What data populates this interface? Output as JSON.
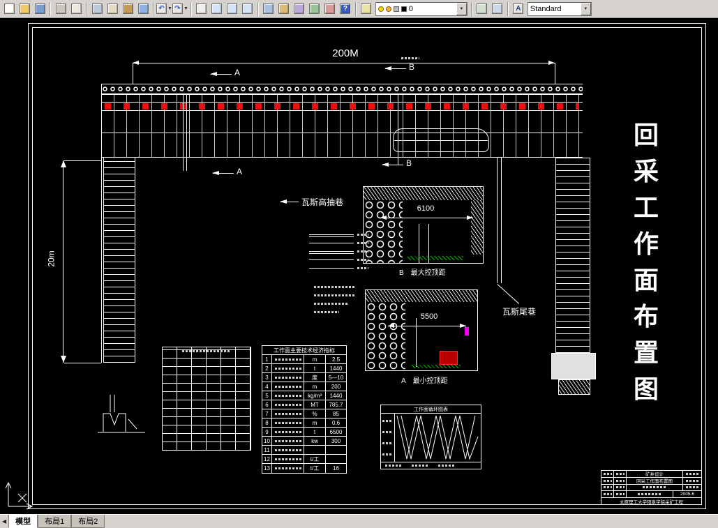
{
  "toolbar": {
    "items": [
      {
        "n": "new-button",
        "icon": "new-file-icon",
        "c": "#fdfdf5"
      },
      {
        "n": "open-button",
        "icon": "open-folder-icon",
        "c": "#f2c96a"
      },
      {
        "n": "save-button",
        "icon": "save-icon",
        "c": "#7b9ad0"
      },
      {
        "sep": true
      },
      {
        "n": "plot-button",
        "icon": "printer-icon",
        "c": "#c9c6be"
      },
      {
        "n": "plot-preview-button",
        "icon": "print-preview-icon",
        "c": "#eceadf"
      },
      {
        "sep": true
      },
      {
        "n": "cut-button",
        "icon": "scissors-icon",
        "c": "#bcc9d8"
      },
      {
        "n": "copy-button",
        "icon": "copy-icon",
        "c": "#e3dcc0"
      },
      {
        "n": "paste-button",
        "icon": "clipboard-icon",
        "c": "#c49a56"
      },
      {
        "n": "match-properties-button",
        "icon": "paintbrush-icon",
        "c": "#8fb0e0"
      },
      {
        "sep": true
      },
      {
        "n": "undo-button",
        "icon": "undo-arrow-icon",
        "c": "#e9e7e0",
        "glyph": "↶",
        "fg": "#2a58c0",
        "drop": true
      },
      {
        "n": "redo-button",
        "icon": "redo-arrow-icon",
        "c": "#e9e7e0",
        "glyph": "↷",
        "fg": "#2a58c0",
        "drop": true
      },
      {
        "sep": true
      },
      {
        "n": "pan-button",
        "icon": "pan-hand-icon",
        "c": "#efefef"
      },
      {
        "n": "zoom-realtime-button",
        "icon": "zoom-realtime-icon",
        "c": "#d4e2f6"
      },
      {
        "n": "zoom-window-button",
        "icon": "zoom-window-icon",
        "c": "#d4e2f6"
      },
      {
        "n": "zoom-previous-button",
        "icon": "zoom-previous-icon",
        "c": "#d4e2f6"
      },
      {
        "sep": true
      },
      {
        "n": "properties-button",
        "icon": "properties-palette-icon",
        "c": "#a9c2e2"
      },
      {
        "n": "designcenter-button",
        "icon": "designcenter-icon",
        "c": "#d9ba79"
      },
      {
        "n": "tool-palettes-button",
        "icon": "tool-palettes-icon",
        "c": "#baa9da"
      },
      {
        "n": "sheet-set-manager-button",
        "icon": "sheet-set-icon",
        "c": "#9cc29c"
      },
      {
        "n": "markup-set-manager-button",
        "icon": "markup-icon",
        "c": "#d99a9a"
      },
      {
        "n": "help-button",
        "icon": "help-question-icon",
        "c": "#3a5cbe",
        "glyph": "?",
        "fg": "#ffffff"
      },
      {
        "sep": true
      }
    ],
    "layer_combo": {
      "value": "0"
    },
    "style_combo": {
      "value": "Standard"
    }
  },
  "drawing": {
    "dim_top": "200M",
    "dim_left": "20m",
    "marker_a": "A",
    "marker_b": "B",
    "label_gas_drainage": "瓦斯高抽巷",
    "label_gas_tail": "瓦斯尾巷",
    "section_b": {
      "dim": "6100",
      "letter": "B",
      "caption": "最大控顶距"
    },
    "section_a": {
      "dim": "5500",
      "letter": "A",
      "caption": "最小控顶距"
    },
    "side_title": "回采工作面布置图",
    "indicator_table": {
      "title": "工作面主要技术经济指标",
      "rows": [
        {
          "no": "1",
          "unit": "m",
          "value": "2.5"
        },
        {
          "no": "2",
          "unit": "t",
          "value": "1440"
        },
        {
          "no": "3",
          "unit": "度",
          "value": "5—10"
        },
        {
          "no": "4",
          "unit": "m",
          "value": "200"
        },
        {
          "no": "5",
          "unit": "kg/m³",
          "value": "1440"
        },
        {
          "no": "6",
          "unit": "MT",
          "value": "785.7"
        },
        {
          "no": "7",
          "unit": "%",
          "value": "85"
        },
        {
          "no": "8",
          "unit": "m",
          "value": "0.6"
        },
        {
          "no": "9",
          "unit": "t",
          "value": "6500"
        },
        {
          "no": "10",
          "unit": "kw",
          "value": "300"
        },
        {
          "no": "11",
          "unit": "",
          "value": ""
        },
        {
          "no": "12",
          "unit": "t/工",
          "value": ""
        },
        {
          "no": "13",
          "unit": "t/工",
          "value": "16"
        }
      ]
    },
    "cycle_chart_title": "工作面循环图表",
    "title_block": {
      "project": "矿井设计",
      "name": "回采工作面布置图",
      "date": "2005.6",
      "org": "太原理工大学阳泉学院采矿工程"
    }
  },
  "tabs": [
    {
      "label": "模型",
      "active": true
    },
    {
      "label": "布局1",
      "active": false
    },
    {
      "label": "布局2",
      "active": false
    }
  ],
  "colors": {
    "support_red": "#e81010",
    "hatch_green": "#00c000",
    "line_white": "#ffffff",
    "toolbar_bg": "#d6d3ce"
  }
}
